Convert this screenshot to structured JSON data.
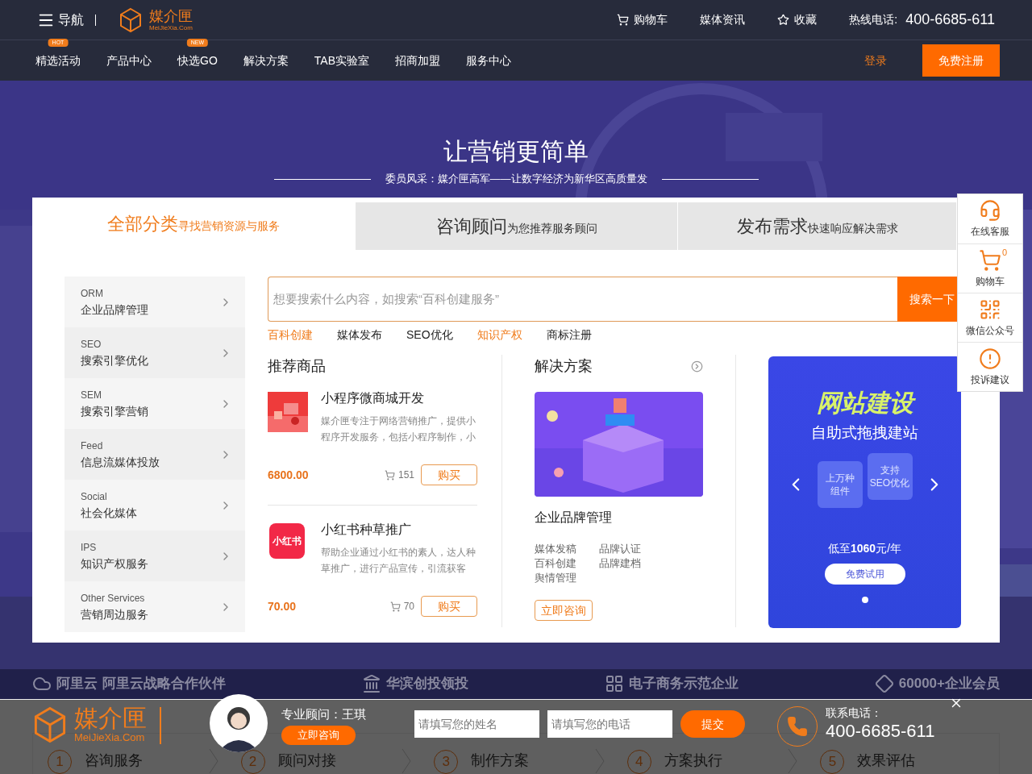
{
  "header": {
    "menu_label": "导航",
    "logo": {
      "name": "媒介匣",
      "domain": "MeiJieXia.Com"
    },
    "links": [
      {
        "label": "购物车"
      },
      {
        "label": "媒体资讯"
      },
      {
        "label": "收藏"
      }
    ],
    "hotline": {
      "label": "热线电话:",
      "number": "400-6685-611"
    }
  },
  "nav": {
    "items": [
      {
        "label": "精选活动",
        "badge": "HOT"
      },
      {
        "label": "产品中心"
      },
      {
        "label": "快选GO",
        "badge": "NEW"
      },
      {
        "label": "解决方案"
      },
      {
        "label": "TAB实验室"
      },
      {
        "label": "招商加盟"
      },
      {
        "label": "服务中心"
      }
    ],
    "login": "登录",
    "register": "免费注册"
  },
  "hero": {
    "title": "让营销更简单",
    "news": "委员风采：媒介匣高军——让数字经济为新华区高质量发"
  },
  "tabs": [
    {
      "title": "全部分类",
      "subtitle": "寻找营销资源与服务",
      "selected": true
    },
    {
      "title": "咨询顾问",
      "subtitle": "为您推荐服务顾问",
      "selected": false
    },
    {
      "title": "发布需求",
      "subtitle": "快速响应解决需求",
      "selected": false
    }
  ],
  "categories": [
    {
      "code": "ORM",
      "label": "企业品牌管理"
    },
    {
      "code": "SEO",
      "label": "搜索引擎优化"
    },
    {
      "code": "SEM",
      "label": "搜索引擎营销"
    },
    {
      "code": "Feed",
      "label": "信息流媒体投放"
    },
    {
      "code": "Social",
      "label": "社会化媒体"
    },
    {
      "code": "IPS",
      "label": "知识产权服务"
    },
    {
      "code": "Other Services",
      "label": "营销周边服务"
    }
  ],
  "search": {
    "placeholder": "想要搜索什么内容，如搜索“百科创建服务”",
    "button": "搜索一下"
  },
  "hot_keywords": [
    {
      "label": "百科创建",
      "highlighted": true
    },
    {
      "label": "媒体发布",
      "highlighted": false
    },
    {
      "label": "SEO优化",
      "highlighted": false
    },
    {
      "label": "知识产权",
      "highlighted": true
    },
    {
      "label": "商标注册",
      "highlighted": false
    }
  ],
  "products": {
    "title": "推荐商品",
    "items": [
      {
        "name": "小程序微商城开发",
        "description_lines": [
          "媒介匣专注于网络营销推广，提供小",
          "程序开发服务，包括小程序制作，小"
        ],
        "price": "6800.00",
        "sales": "151",
        "buy": "购买",
        "thumb": {
          "kind": "picture"
        }
      },
      {
        "name": "小红书种草推广",
        "description_lines": [
          "帮助企业通过小红书的素人，达人种",
          "草推广，进行产品宣传，引流获客"
        ],
        "price": "70.00",
        "sales": "70",
        "buy": "购买",
        "thumb": {
          "kind": "logo",
          "text": "小红书"
        }
      }
    ]
  },
  "solutions": {
    "title": "解决方案",
    "item_title": "企业品牌管理",
    "tags": [
      "媒体发稿",
      "百科创建",
      "舆情管理",
      "品牌认证",
      "品牌建档"
    ],
    "consult": "立即咨询"
  },
  "banner": {
    "title": "网站建设",
    "subtitle": "自助式拖拽建站",
    "features": [
      [
        "上万种",
        "组件"
      ],
      [
        "支持",
        "SEO优化"
      ]
    ],
    "price": "低至**1060**元/年",
    "button": "免费试用"
  },
  "side_toolbar": [
    {
      "label": "在线客服"
    },
    {
      "label": "购物车",
      "count": "0"
    },
    {
      "label": "微信公众号"
    },
    {
      "label": "投诉建议"
    }
  ],
  "partners": [
    {
      "logo_text": "阿里云",
      "label": "阿里云战略合作伙伴"
    },
    {
      "label": "华滨创投领投"
    },
    {
      "label": "电子商务示范企业"
    },
    {
      "label": "60000+企业会员"
    }
  ],
  "steps": [
    {
      "number": "1",
      "label": "咨询服务"
    },
    {
      "number": "2",
      "label": "顾问对接"
    },
    {
      "number": "3",
      "label": "制作方案"
    },
    {
      "number": "4",
      "label": "方案执行"
    },
    {
      "number": "5",
      "label": "效果评估"
    }
  ],
  "consult_bar": {
    "logo": {
      "name": "媒介匣",
      "domain": "MeiJieXia.Com"
    },
    "advisor": "专业顾问：王琪",
    "consult": "立即咨询",
    "name_placeholder": "请填写您的姓名",
    "phone_placeholder": "请填写您的电话",
    "submit": "提交",
    "phone_label": "联系电话：",
    "phone": "400-6685-611"
  }
}
